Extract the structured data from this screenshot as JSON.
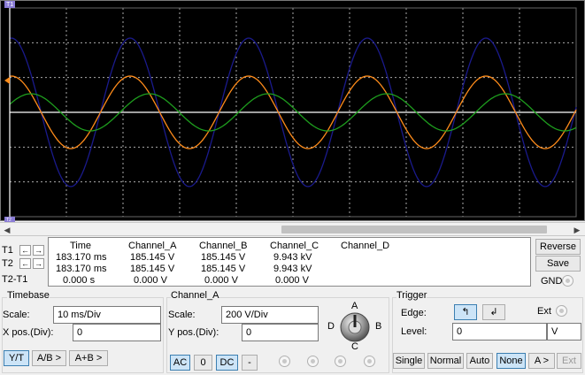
{
  "colors": {
    "channel_a": "#ff8c1a",
    "channel_b": "#1e9e1e",
    "channel_c": "#1a1a8c",
    "cursor": "#ffffff",
    "grid": "#aaaaaa"
  },
  "markers": {
    "t1_marker": "T1",
    "t2_marker": "T2"
  },
  "cursors": {
    "t1": "T1",
    "t2": "T2",
    "t2_t1": "T2-T1"
  },
  "readout": {
    "headers": [
      "Time",
      "Channel_A",
      "Channel_B",
      "Channel_C",
      "Channel_D"
    ],
    "rows": [
      [
        "183.170 ms",
        "185.145 V",
        "185.145 V",
        "9.943 kV",
        ""
      ],
      [
        "183.170 ms",
        "185.145 V",
        "185.145 V",
        "9.943 kV",
        ""
      ],
      [
        "0.000 s",
        "0.000 V",
        "0.000 V",
        "0.000 V",
        ""
      ]
    ]
  },
  "side": {
    "reverse": "Reverse",
    "save": "Save",
    "gnd": "GND"
  },
  "timebase": {
    "title": "Timebase",
    "scale_label": "Scale:",
    "scale_value": "10 ms/Div",
    "xpos_label": "X pos.(Div):",
    "xpos_value": "0",
    "buttons": [
      "Y/T",
      "A/B >",
      "A+B >"
    ]
  },
  "channel": {
    "title": "Channel_A",
    "scale_label": "Scale:",
    "scale_value": "200  V/Div",
    "ypos_label": "Y pos.(Div):",
    "ypos_value": "0",
    "buttons": [
      "AC",
      "0",
      "DC",
      "-"
    ],
    "knob": {
      "a": "A",
      "b": "B",
      "c": "C",
      "d": "D"
    }
  },
  "trigger": {
    "title": "Trigger",
    "edge_label": "Edge:",
    "ext_label": "Ext",
    "level_label": "Level:",
    "level_value": "0",
    "level_unit": "V",
    "buttons": [
      "Single",
      "Normal",
      "Auto",
      "None",
      "A >",
      "Ext"
    ]
  }
}
